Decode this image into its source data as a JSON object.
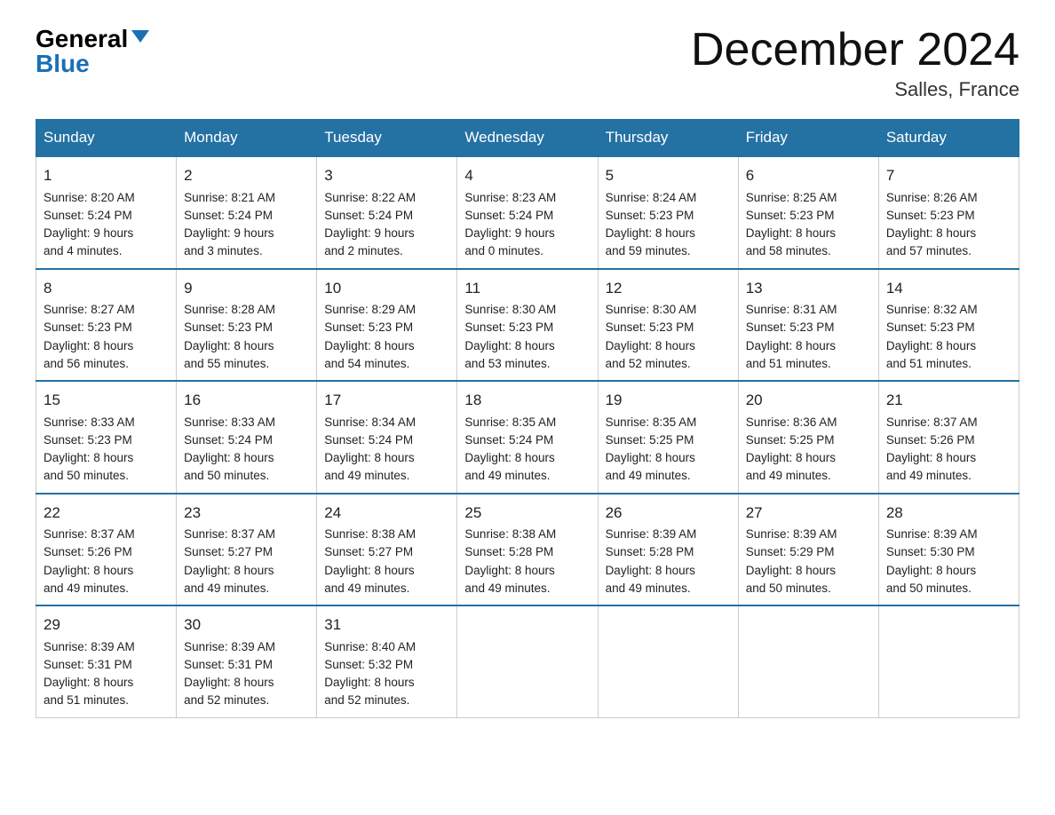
{
  "logo": {
    "general": "General",
    "blue": "Blue"
  },
  "header": {
    "month_title": "December 2024",
    "location": "Salles, France"
  },
  "columns": [
    "Sunday",
    "Monday",
    "Tuesday",
    "Wednesday",
    "Thursday",
    "Friday",
    "Saturday"
  ],
  "weeks": [
    [
      {
        "day": "1",
        "info": "Sunrise: 8:20 AM\nSunset: 5:24 PM\nDaylight: 9 hours\nand 4 minutes."
      },
      {
        "day": "2",
        "info": "Sunrise: 8:21 AM\nSunset: 5:24 PM\nDaylight: 9 hours\nand 3 minutes."
      },
      {
        "day": "3",
        "info": "Sunrise: 8:22 AM\nSunset: 5:24 PM\nDaylight: 9 hours\nand 2 minutes."
      },
      {
        "day": "4",
        "info": "Sunrise: 8:23 AM\nSunset: 5:24 PM\nDaylight: 9 hours\nand 0 minutes."
      },
      {
        "day": "5",
        "info": "Sunrise: 8:24 AM\nSunset: 5:23 PM\nDaylight: 8 hours\nand 59 minutes."
      },
      {
        "day": "6",
        "info": "Sunrise: 8:25 AM\nSunset: 5:23 PM\nDaylight: 8 hours\nand 58 minutes."
      },
      {
        "day": "7",
        "info": "Sunrise: 8:26 AM\nSunset: 5:23 PM\nDaylight: 8 hours\nand 57 minutes."
      }
    ],
    [
      {
        "day": "8",
        "info": "Sunrise: 8:27 AM\nSunset: 5:23 PM\nDaylight: 8 hours\nand 56 minutes."
      },
      {
        "day": "9",
        "info": "Sunrise: 8:28 AM\nSunset: 5:23 PM\nDaylight: 8 hours\nand 55 minutes."
      },
      {
        "day": "10",
        "info": "Sunrise: 8:29 AM\nSunset: 5:23 PM\nDaylight: 8 hours\nand 54 minutes."
      },
      {
        "day": "11",
        "info": "Sunrise: 8:30 AM\nSunset: 5:23 PM\nDaylight: 8 hours\nand 53 minutes."
      },
      {
        "day": "12",
        "info": "Sunrise: 8:30 AM\nSunset: 5:23 PM\nDaylight: 8 hours\nand 52 minutes."
      },
      {
        "day": "13",
        "info": "Sunrise: 8:31 AM\nSunset: 5:23 PM\nDaylight: 8 hours\nand 51 minutes."
      },
      {
        "day": "14",
        "info": "Sunrise: 8:32 AM\nSunset: 5:23 PM\nDaylight: 8 hours\nand 51 minutes."
      }
    ],
    [
      {
        "day": "15",
        "info": "Sunrise: 8:33 AM\nSunset: 5:23 PM\nDaylight: 8 hours\nand 50 minutes."
      },
      {
        "day": "16",
        "info": "Sunrise: 8:33 AM\nSunset: 5:24 PM\nDaylight: 8 hours\nand 50 minutes."
      },
      {
        "day": "17",
        "info": "Sunrise: 8:34 AM\nSunset: 5:24 PM\nDaylight: 8 hours\nand 49 minutes."
      },
      {
        "day": "18",
        "info": "Sunrise: 8:35 AM\nSunset: 5:24 PM\nDaylight: 8 hours\nand 49 minutes."
      },
      {
        "day": "19",
        "info": "Sunrise: 8:35 AM\nSunset: 5:25 PM\nDaylight: 8 hours\nand 49 minutes."
      },
      {
        "day": "20",
        "info": "Sunrise: 8:36 AM\nSunset: 5:25 PM\nDaylight: 8 hours\nand 49 minutes."
      },
      {
        "day": "21",
        "info": "Sunrise: 8:37 AM\nSunset: 5:26 PM\nDaylight: 8 hours\nand 49 minutes."
      }
    ],
    [
      {
        "day": "22",
        "info": "Sunrise: 8:37 AM\nSunset: 5:26 PM\nDaylight: 8 hours\nand 49 minutes."
      },
      {
        "day": "23",
        "info": "Sunrise: 8:37 AM\nSunset: 5:27 PM\nDaylight: 8 hours\nand 49 minutes."
      },
      {
        "day": "24",
        "info": "Sunrise: 8:38 AM\nSunset: 5:27 PM\nDaylight: 8 hours\nand 49 minutes."
      },
      {
        "day": "25",
        "info": "Sunrise: 8:38 AM\nSunset: 5:28 PM\nDaylight: 8 hours\nand 49 minutes."
      },
      {
        "day": "26",
        "info": "Sunrise: 8:39 AM\nSunset: 5:28 PM\nDaylight: 8 hours\nand 49 minutes."
      },
      {
        "day": "27",
        "info": "Sunrise: 8:39 AM\nSunset: 5:29 PM\nDaylight: 8 hours\nand 50 minutes."
      },
      {
        "day": "28",
        "info": "Sunrise: 8:39 AM\nSunset: 5:30 PM\nDaylight: 8 hours\nand 50 minutes."
      }
    ],
    [
      {
        "day": "29",
        "info": "Sunrise: 8:39 AM\nSunset: 5:31 PM\nDaylight: 8 hours\nand 51 minutes."
      },
      {
        "day": "30",
        "info": "Sunrise: 8:39 AM\nSunset: 5:31 PM\nDaylight: 8 hours\nand 52 minutes."
      },
      {
        "day": "31",
        "info": "Sunrise: 8:40 AM\nSunset: 5:32 PM\nDaylight: 8 hours\nand 52 minutes."
      },
      {
        "day": "",
        "info": ""
      },
      {
        "day": "",
        "info": ""
      },
      {
        "day": "",
        "info": ""
      },
      {
        "day": "",
        "info": ""
      }
    ]
  ]
}
